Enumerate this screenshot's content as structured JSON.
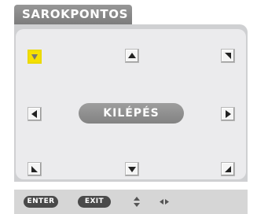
{
  "dialog": {
    "title": "SAROKPONTOS",
    "exit_label": "KILÉPÉS"
  },
  "corners": [
    {
      "name": "corner-top-left",
      "direction": "down-right",
      "selected": true
    },
    {
      "name": "corner-top-center",
      "direction": "up",
      "selected": false
    },
    {
      "name": "corner-top-right",
      "direction": "down-left",
      "selected": false
    },
    {
      "name": "corner-middle-left",
      "direction": "left",
      "selected": false
    },
    {
      "name": "corner-middle-right",
      "direction": "right",
      "selected": false
    },
    {
      "name": "corner-bottom-left",
      "direction": "up-right",
      "selected": false
    },
    {
      "name": "corner-bottom-center",
      "direction": "down",
      "selected": false
    },
    {
      "name": "corner-bottom-right",
      "direction": "up-left",
      "selected": false
    }
  ],
  "footer": {
    "enter_label": "ENTER",
    "exit_label": "EXIT",
    "updown_icon": "up-down-arrows-icon",
    "leftright_icon": "left-right-arrows-icon"
  },
  "colors": {
    "selected": "#f6e000",
    "title_bar": "#8a8a8a",
    "panel": "#ebebed"
  }
}
